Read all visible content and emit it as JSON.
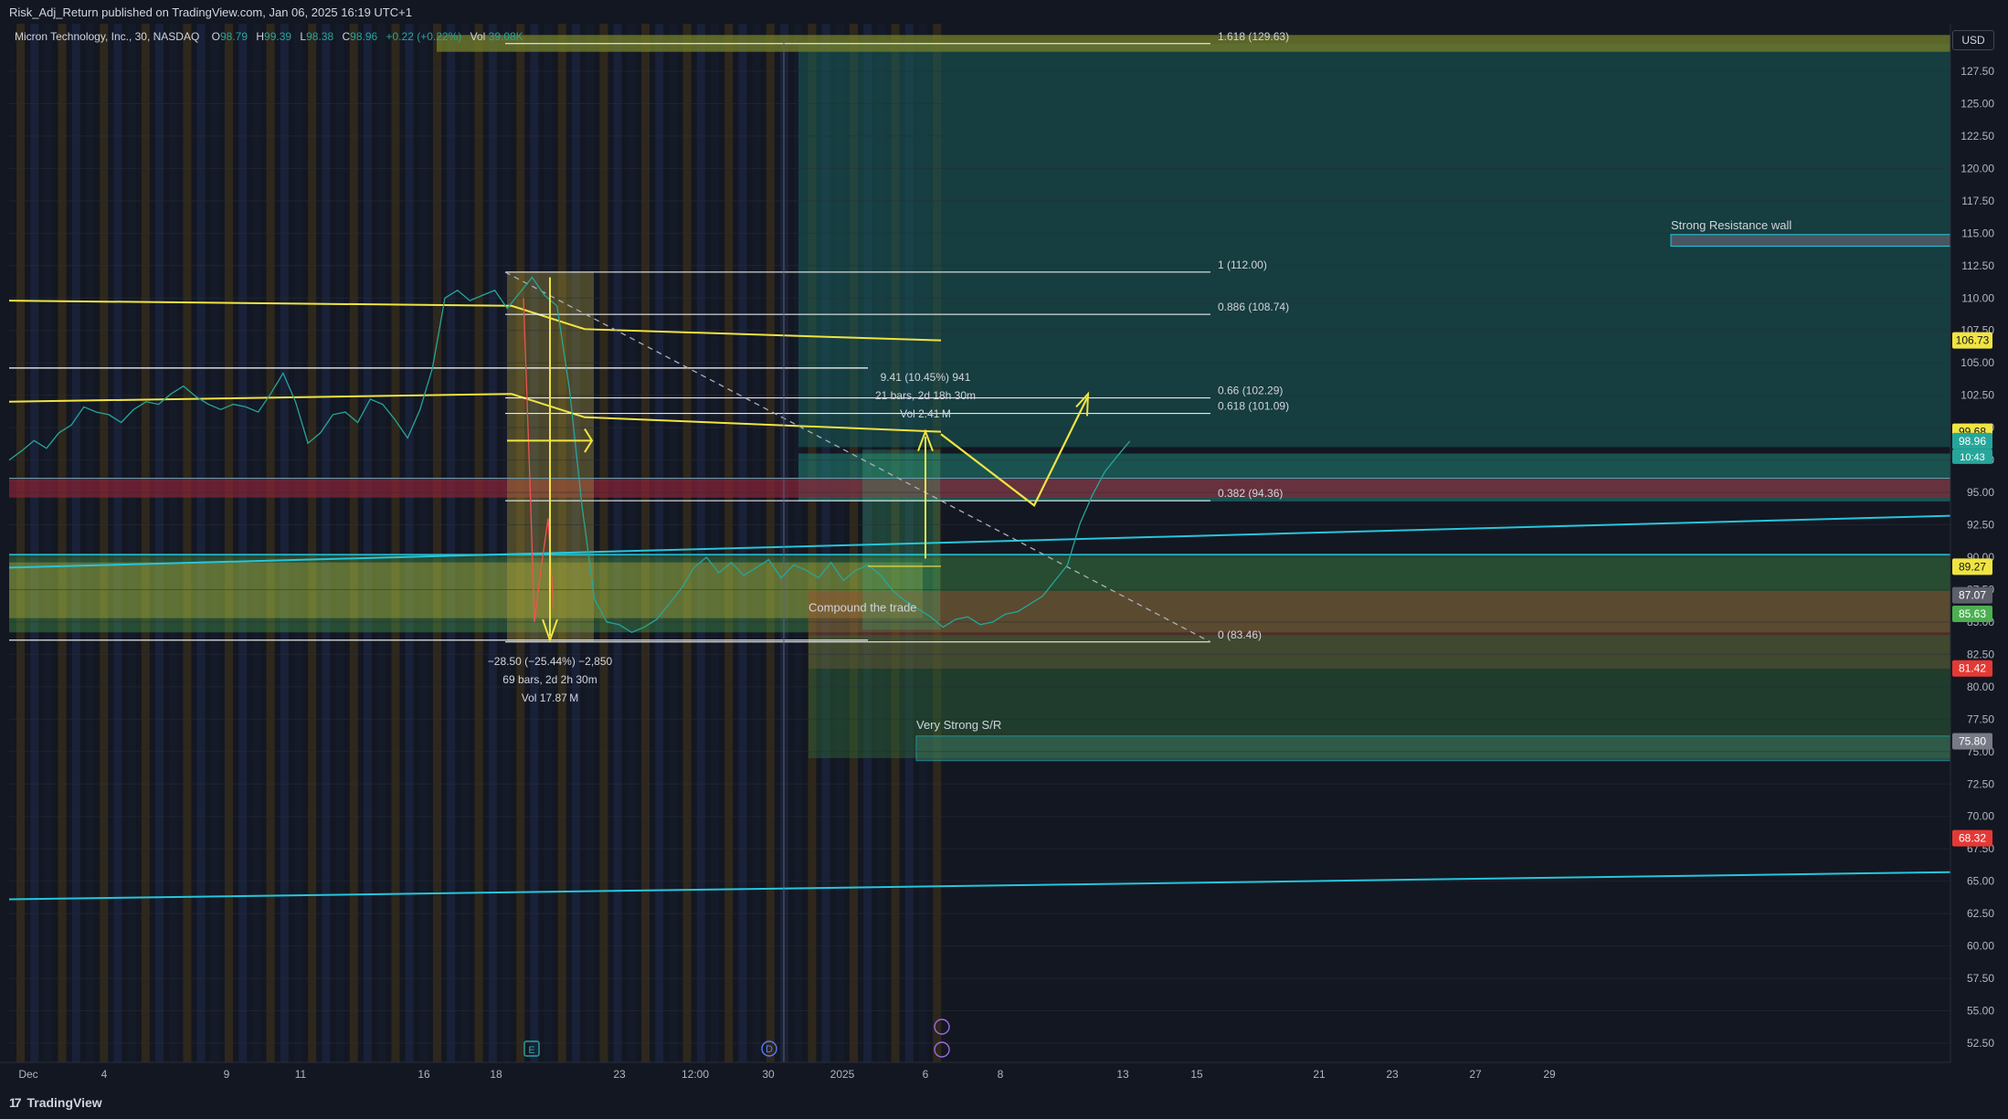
{
  "header": {
    "publisher_line": "Risk_Adj_Return published on TradingView.com, Jan 06, 2025 16:19 UTC+1"
  },
  "legend": {
    "symbol": "Micron Technology, Inc., 30, NASDAQ",
    "open_label": "O",
    "open": "98.79",
    "high_label": "H",
    "high": "99.39",
    "low_label": "L",
    "low": "98.38",
    "close_label": "C",
    "close": "98.96",
    "change": "+0.22 (+0.22%)",
    "vol_label": "Vol",
    "vol": "39.08K"
  },
  "currency": "USD",
  "footer": {
    "brand": "TradingView"
  },
  "colors": {
    "background": "#131722",
    "grid": "#2a2e39",
    "yellow": "#f0e442",
    "cyan": "#26c6da",
    "green_zone": "#4caf50",
    "red_zone": "#e53935",
    "teal_zone": "#1a5c57",
    "white": "#ffffff"
  },
  "chart_data": {
    "type": "line",
    "title": "Micron Technology, Inc., 30, NASDAQ",
    "ylim": [
      50.0,
      131.5
    ],
    "y_ticks": [
      52.5,
      55.0,
      57.5,
      60.0,
      62.5,
      65.0,
      67.5,
      70.0,
      72.5,
      75.0,
      77.5,
      80.0,
      82.5,
      85.0,
      87.5,
      90.0,
      92.5,
      95.0,
      97.5,
      100.0,
      102.5,
      105.0,
      107.5,
      110.0,
      112.5,
      115.0,
      117.5,
      120.0,
      122.5,
      125.0,
      127.5
    ],
    "y_tick_labels": [
      "52.50",
      "55.00",
      "57.50",
      "60.00",
      "62.50",
      "65.00",
      "67.50",
      "70.00",
      "72.50",
      "75.00",
      "77.50",
      "80.00",
      "82.50",
      "85.00",
      "87.50",
      "90.00",
      "92.50",
      "95.00",
      "97.50",
      "100.00",
      "102.50",
      "105.00",
      "107.50",
      "110.00",
      "112.50",
      "115.00",
      "117.50",
      "120.00",
      "122.50",
      "125.00",
      "127.50"
    ],
    "x_tick_labels": [
      "Dec",
      "4",
      "9",
      "11",
      "16",
      "18",
      "23",
      "12:00",
      "30",
      "2025",
      "6",
      "8",
      "13",
      "15",
      "21",
      "23",
      "27",
      "29"
    ],
    "price_series": {
      "name": "MU 30m",
      "x": [
        0,
        4,
        8,
        12,
        16,
        20,
        24,
        28,
        32,
        36,
        40,
        44,
        48,
        52,
        56,
        60,
        64,
        68,
        72,
        76,
        80,
        84,
        88,
        92,
        96,
        100,
        104,
        108,
        112,
        116,
        120,
        124,
        128,
        132,
        136,
        140,
        144,
        148,
        152,
        156,
        160,
        164,
        168,
        172,
        176,
        180,
        184,
        188,
        192,
        196,
        200,
        204,
        208,
        212,
        216,
        220,
        224,
        228,
        232,
        236,
        240,
        244,
        248,
        252,
        256,
        260,
        264,
        268,
        272,
        276,
        280,
        284,
        288,
        292,
        296,
        300,
        304,
        308,
        312,
        316,
        320,
        324,
        328,
        332,
        336,
        340,
        344,
        348,
        352,
        356,
        360,
        364,
        368,
        372,
        376,
        380,
        384,
        388,
        392,
        396,
        400,
        404,
        408,
        412,
        416,
        420,
        424,
        428,
        432,
        436,
        440,
        444,
        448,
        452,
        456,
        460,
        464,
        468,
        472,
        476,
        480,
        484,
        488,
        492,
        496,
        500,
        504,
        508,
        512,
        516,
        520,
        524,
        528,
        532,
        536,
        540,
        544,
        548,
        552,
        556,
        560
      ],
      "y": [
        97.5,
        98.2,
        99.0,
        98.4,
        99.6,
        100.2,
        101.6,
        101.2,
        101.0,
        100.4,
        101.4,
        102.0,
        101.8,
        102.6,
        103.2,
        102.4,
        101.8,
        101.4,
        101.8,
        101.6,
        101.2,
        102.6,
        104.2,
        102.0,
        98.8,
        99.6,
        101.0,
        101.2,
        100.4,
        102.2,
        101.8,
        100.6,
        99.2,
        101.4,
        104.6,
        110.0,
        110.6,
        109.8,
        110.2,
        110.6,
        109.2,
        110.4,
        111.6,
        110.2,
        109.4,
        103.0,
        94.0,
        86.8,
        85.0,
        84.8,
        84.2,
        84.6,
        85.2,
        86.4,
        87.6,
        89.2,
        90.0,
        88.8,
        89.6,
        88.6,
        89.2,
        89.8,
        88.4,
        89.4,
        89.0,
        88.4,
        89.6,
        88.2,
        89.0,
        89.4,
        88.6,
        87.4,
        86.6,
        86.0,
        85.4,
        84.6,
        85.2,
        85.4,
        84.8,
        85.0,
        85.6,
        85.8,
        86.4,
        87.0,
        88.2,
        89.4,
        92.6,
        94.8,
        96.6,
        97.8,
        98.96,
        98.96,
        98.96,
        98.96,
        98.96,
        98.96,
        98.96,
        98.96,
        98.96,
        98.96,
        98.96,
        98.96,
        98.96,
        98.96,
        98.96,
        98.96,
        98.96,
        98.96,
        98.96,
        98.96,
        98.96,
        98.96,
        98.96,
        98.96,
        98.96,
        98.96,
        98.96,
        98.96,
        98.96,
        98.96,
        98.96,
        98.96,
        98.96,
        98.96,
        98.96,
        98.96,
        98.96,
        98.96,
        98.96,
        98.96,
        98.96,
        98.96,
        98.96,
        98.96,
        98.96,
        98.96,
        98.96,
        98.96,
        98.96,
        98.96,
        98.96
      ]
    },
    "fibonacci": [
      {
        "level": "1.618",
        "price": 129.63,
        "label": "1.618 (129.63)"
      },
      {
        "level": "1",
        "price": 112.0,
        "label": "1 (112.00)"
      },
      {
        "level": "0.886",
        "price": 108.74,
        "label": "0.886 (108.74)"
      },
      {
        "level": "0.66",
        "price": 102.29,
        "label": "0.66 (102.29)"
      },
      {
        "level": "0.618",
        "price": 101.09,
        "label": "0.618 (101.09)"
      },
      {
        "level": "0.382",
        "price": 94.36,
        "label": "0.382 (94.36)"
      },
      {
        "level": "0",
        "price": 83.46,
        "label": "0 (83.46)"
      }
    ],
    "price_badges": [
      {
        "price": 106.73,
        "label": "106.73",
        "color": "#f0e442",
        "text": "#131722"
      },
      {
        "price": 99.68,
        "label": "99.68",
        "color": "#f0e442",
        "text": "#131722"
      },
      {
        "price": 98.96,
        "label": "98.96",
        "color": "#26a69a",
        "text": "#ffffff"
      },
      {
        "price": 89.27,
        "label": "89.27",
        "color": "#f0e442",
        "text": "#131722"
      },
      {
        "price": 87.07,
        "label": "87.07",
        "color": "#5d606b",
        "text": "#ffffff"
      },
      {
        "price": 85.63,
        "label": "85.63",
        "color": "#4caf50",
        "text": "#ffffff"
      },
      {
        "price": 81.42,
        "label": "81.42",
        "color": "#e53935",
        "text": "#ffffff"
      },
      {
        "price": 75.8,
        "label": "75.80",
        "color": "#787b86",
        "text": "#ffffff"
      },
      {
        "price": 68.32,
        "label": "68.32",
        "color": "#e53935",
        "text": "#ffffff"
      }
    ],
    "countdown": "10:43",
    "annotations": {
      "strong_resistance": "Strong Resistance wall",
      "very_strong_sr": "Very Strong S/R",
      "compound": "Compound the trade",
      "measure_down": [
        "−28.50 (−25.44%) −2,850",
        "69 bars, 2d 2h 30m",
        "Vol 17.87 M"
      ],
      "measure_up": [
        "9.41 (10.45%) 941",
        "21 bars, 2d 18h 30m",
        "Vol 2.41 M"
      ],
      "event_letters": [
        "E",
        "D"
      ]
    }
  }
}
